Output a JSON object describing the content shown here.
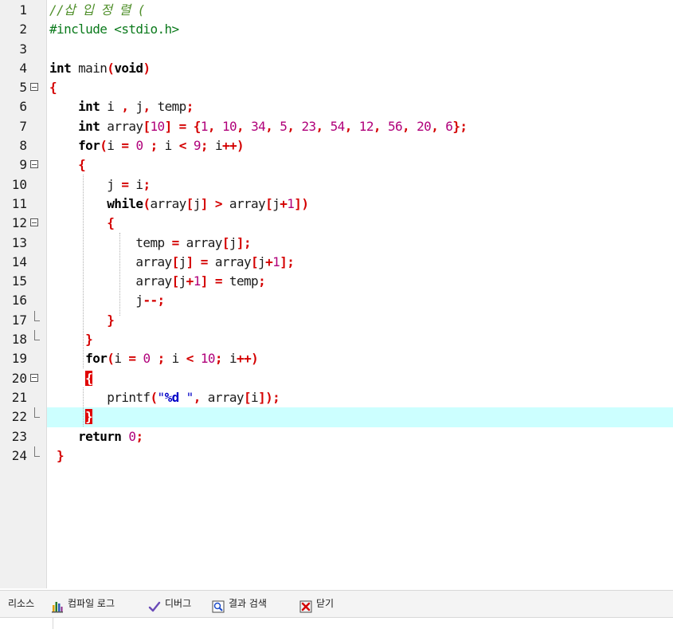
{
  "editor": {
    "current_line": 22,
    "lines": [
      {
        "n": "1",
        "fold": "none",
        "tokens": [
          {
            "t": "//삽 입 정 렬 (",
            "c": "comment"
          }
        ]
      },
      {
        "n": "2",
        "fold": "none",
        "tokens": [
          {
            "t": "#include <stdio.h>",
            "c": "pp"
          }
        ]
      },
      {
        "n": "3",
        "fold": "none",
        "tokens": []
      },
      {
        "n": "4",
        "fold": "none",
        "tokens": [
          {
            "t": "int",
            "c": "kw"
          },
          {
            "t": " main"
          },
          {
            "t": "(",
            "c": "op"
          },
          {
            "t": "void",
            "c": "kw"
          },
          {
            "t": ")",
            "c": "op"
          }
        ]
      },
      {
        "n": "5",
        "fold": "start",
        "tokens": [
          {
            "t": "{",
            "c": "op"
          }
        ]
      },
      {
        "n": "6",
        "fold": "none",
        "tokens": [
          {
            "t": "    "
          },
          {
            "t": "int",
            "c": "kw"
          },
          {
            "t": " i "
          },
          {
            "t": ",",
            "c": "op"
          },
          {
            "t": " j"
          },
          {
            "t": ",",
            "c": "op"
          },
          {
            "t": " temp"
          },
          {
            "t": ";",
            "c": "op"
          }
        ]
      },
      {
        "n": "7",
        "fold": "none",
        "tokens": [
          {
            "t": "    "
          },
          {
            "t": "int",
            "c": "kw"
          },
          {
            "t": " array"
          },
          {
            "t": "[",
            "c": "op"
          },
          {
            "t": "10",
            "c": "num"
          },
          {
            "t": "]",
            "c": "op"
          },
          {
            "t": " "
          },
          {
            "t": "=",
            "c": "op"
          },
          {
            "t": " "
          },
          {
            "t": "{",
            "c": "op"
          },
          {
            "t": "1",
            "c": "num"
          },
          {
            "t": ",",
            "c": "op"
          },
          {
            "t": " "
          },
          {
            "t": "10",
            "c": "num"
          },
          {
            "t": ",",
            "c": "op"
          },
          {
            "t": " "
          },
          {
            "t": "34",
            "c": "num"
          },
          {
            "t": ",",
            "c": "op"
          },
          {
            "t": " "
          },
          {
            "t": "5",
            "c": "num"
          },
          {
            "t": ",",
            "c": "op"
          },
          {
            "t": " "
          },
          {
            "t": "23",
            "c": "num"
          },
          {
            "t": ",",
            "c": "op"
          },
          {
            "t": " "
          },
          {
            "t": "54",
            "c": "num"
          },
          {
            "t": ",",
            "c": "op"
          },
          {
            "t": " "
          },
          {
            "t": "12",
            "c": "num"
          },
          {
            "t": ",",
            "c": "op"
          },
          {
            "t": " "
          },
          {
            "t": "56",
            "c": "num"
          },
          {
            "t": ",",
            "c": "op"
          },
          {
            "t": " "
          },
          {
            "t": "20",
            "c": "num"
          },
          {
            "t": ",",
            "c": "op"
          },
          {
            "t": " "
          },
          {
            "t": "6",
            "c": "num"
          },
          {
            "t": "};",
            "c": "op"
          }
        ]
      },
      {
        "n": "8",
        "fold": "none",
        "tokens": [
          {
            "t": "    "
          },
          {
            "t": "for",
            "c": "kw"
          },
          {
            "t": "(",
            "c": "op"
          },
          {
            "t": "i "
          },
          {
            "t": "=",
            "c": "op"
          },
          {
            "t": " "
          },
          {
            "t": "0",
            "c": "num"
          },
          {
            "t": " "
          },
          {
            "t": ";",
            "c": "op"
          },
          {
            "t": " i "
          },
          {
            "t": "<",
            "c": "op"
          },
          {
            "t": " "
          },
          {
            "t": "9",
            "c": "num"
          },
          {
            "t": ";",
            "c": "op"
          },
          {
            "t": " i"
          },
          {
            "t": "++)",
            "c": "op"
          }
        ]
      },
      {
        "n": "9",
        "fold": "start",
        "tokens": [
          {
            "t": "    "
          },
          {
            "t": "{",
            "c": "op"
          }
        ]
      },
      {
        "n": "10",
        "fold": "mid",
        "tokens": [
          {
            "t": "        j "
          },
          {
            "t": "=",
            "c": "op"
          },
          {
            "t": " i"
          },
          {
            "t": ";",
            "c": "op"
          }
        ]
      },
      {
        "n": "11",
        "fold": "mid",
        "tokens": [
          {
            "t": "        "
          },
          {
            "t": "while",
            "c": "kw"
          },
          {
            "t": "(",
            "c": "op"
          },
          {
            "t": "array"
          },
          {
            "t": "[",
            "c": "op"
          },
          {
            "t": "j"
          },
          {
            "t": "]",
            "c": "op"
          },
          {
            "t": " "
          },
          {
            "t": ">",
            "c": "op"
          },
          {
            "t": " array"
          },
          {
            "t": "[",
            "c": "op"
          },
          {
            "t": "j"
          },
          {
            "t": "+",
            "c": "op"
          },
          {
            "t": "1",
            "c": "num"
          },
          {
            "t": "])",
            "c": "op"
          }
        ]
      },
      {
        "n": "12",
        "fold": "start",
        "tokens": [
          {
            "t": "        "
          },
          {
            "t": "{",
            "c": "op"
          }
        ]
      },
      {
        "n": "13",
        "fold": "mid",
        "tokens": [
          {
            "t": "            temp "
          },
          {
            "t": "=",
            "c": "op"
          },
          {
            "t": " array"
          },
          {
            "t": "[",
            "c": "op"
          },
          {
            "t": "j"
          },
          {
            "t": "];",
            "c": "op"
          }
        ]
      },
      {
        "n": "14",
        "fold": "mid",
        "tokens": [
          {
            "t": "            array"
          },
          {
            "t": "[",
            "c": "op"
          },
          {
            "t": "j"
          },
          {
            "t": "]",
            "c": "op"
          },
          {
            "t": " "
          },
          {
            "t": "=",
            "c": "op"
          },
          {
            "t": " array"
          },
          {
            "t": "[",
            "c": "op"
          },
          {
            "t": "j"
          },
          {
            "t": "+",
            "c": "op"
          },
          {
            "t": "1",
            "c": "num"
          },
          {
            "t": "];",
            "c": "op"
          }
        ]
      },
      {
        "n": "15",
        "fold": "mid",
        "tokens": [
          {
            "t": "            array"
          },
          {
            "t": "[",
            "c": "op"
          },
          {
            "t": "j"
          },
          {
            "t": "+",
            "c": "op"
          },
          {
            "t": "1",
            "c": "num"
          },
          {
            "t": "]",
            "c": "op"
          },
          {
            "t": " "
          },
          {
            "t": "=",
            "c": "op"
          },
          {
            "t": " temp"
          },
          {
            "t": ";",
            "c": "op"
          }
        ]
      },
      {
        "n": "16",
        "fold": "mid",
        "tokens": [
          {
            "t": "            j"
          },
          {
            "t": "--;",
            "c": "op"
          }
        ]
      },
      {
        "n": "17",
        "fold": "end",
        "tokens": [
          {
            "t": "        "
          },
          {
            "t": "}",
            "c": "op"
          }
        ]
      },
      {
        "n": "18",
        "fold": "end",
        "tokens": [
          {
            "t": "     "
          },
          {
            "t": "}",
            "c": "op"
          }
        ]
      },
      {
        "n": "19",
        "fold": "none",
        "tokens": [
          {
            "t": "     "
          },
          {
            "t": "for",
            "c": "kw"
          },
          {
            "t": "(",
            "c": "op"
          },
          {
            "t": "i "
          },
          {
            "t": "=",
            "c": "op"
          },
          {
            "t": " "
          },
          {
            "t": "0",
            "c": "num"
          },
          {
            "t": " "
          },
          {
            "t": ";",
            "c": "op"
          },
          {
            "t": " i "
          },
          {
            "t": "<",
            "c": "op"
          },
          {
            "t": " "
          },
          {
            "t": "10",
            "c": "num"
          },
          {
            "t": ";",
            "c": "op"
          },
          {
            "t": " i"
          },
          {
            "t": "++)",
            "c": "op"
          }
        ]
      },
      {
        "n": "20",
        "fold": "start",
        "tokens": [
          {
            "t": "     "
          },
          {
            "t": "{",
            "c": "hl"
          }
        ]
      },
      {
        "n": "21",
        "fold": "mid",
        "tokens": [
          {
            "t": "        printf"
          },
          {
            "t": "(",
            "c": "op"
          },
          {
            "t": "\"",
            "c": "str"
          },
          {
            "t": "%d",
            "c": "strfmt"
          },
          {
            "t": " \"",
            "c": "str"
          },
          {
            "t": ",",
            "c": "op"
          },
          {
            "t": " array"
          },
          {
            "t": "[",
            "c": "op"
          },
          {
            "t": "i"
          },
          {
            "t": "]);",
            "c": "op"
          }
        ]
      },
      {
        "n": "22",
        "fold": "end",
        "tokens": [
          {
            "t": "     "
          },
          {
            "t": "}",
            "c": "hl"
          }
        ]
      },
      {
        "n": "23",
        "fold": "none",
        "tokens": [
          {
            "t": "    "
          },
          {
            "t": "return",
            "c": "kw"
          },
          {
            "t": " "
          },
          {
            "t": "0",
            "c": "num"
          },
          {
            "t": ";",
            "c": "op"
          }
        ]
      },
      {
        "n": "24",
        "fold": "last",
        "tokens": [
          {
            "t": " "
          },
          {
            "t": "}",
            "c": "op"
          }
        ]
      }
    ]
  },
  "tabs": [
    {
      "label": "리소스",
      "icon": "none"
    },
    {
      "label": "컴파일 로그",
      "icon": "compile-log-icon"
    },
    {
      "label": "디버그",
      "icon": "debug-check-icon"
    },
    {
      "label": "결과 검색",
      "icon": "search-results-icon"
    },
    {
      "label": "닫기",
      "icon": "close-panel-icon"
    }
  ],
  "colors": {
    "keyword": "#000000",
    "operator": "#d40000",
    "number": "#b0007a",
    "string": "#0000c8",
    "comment": "#4f8f2a",
    "preprocessor": "#0b7a1c",
    "current_line_bg": "#ccffff",
    "bracket_highlight": "#e00000"
  }
}
